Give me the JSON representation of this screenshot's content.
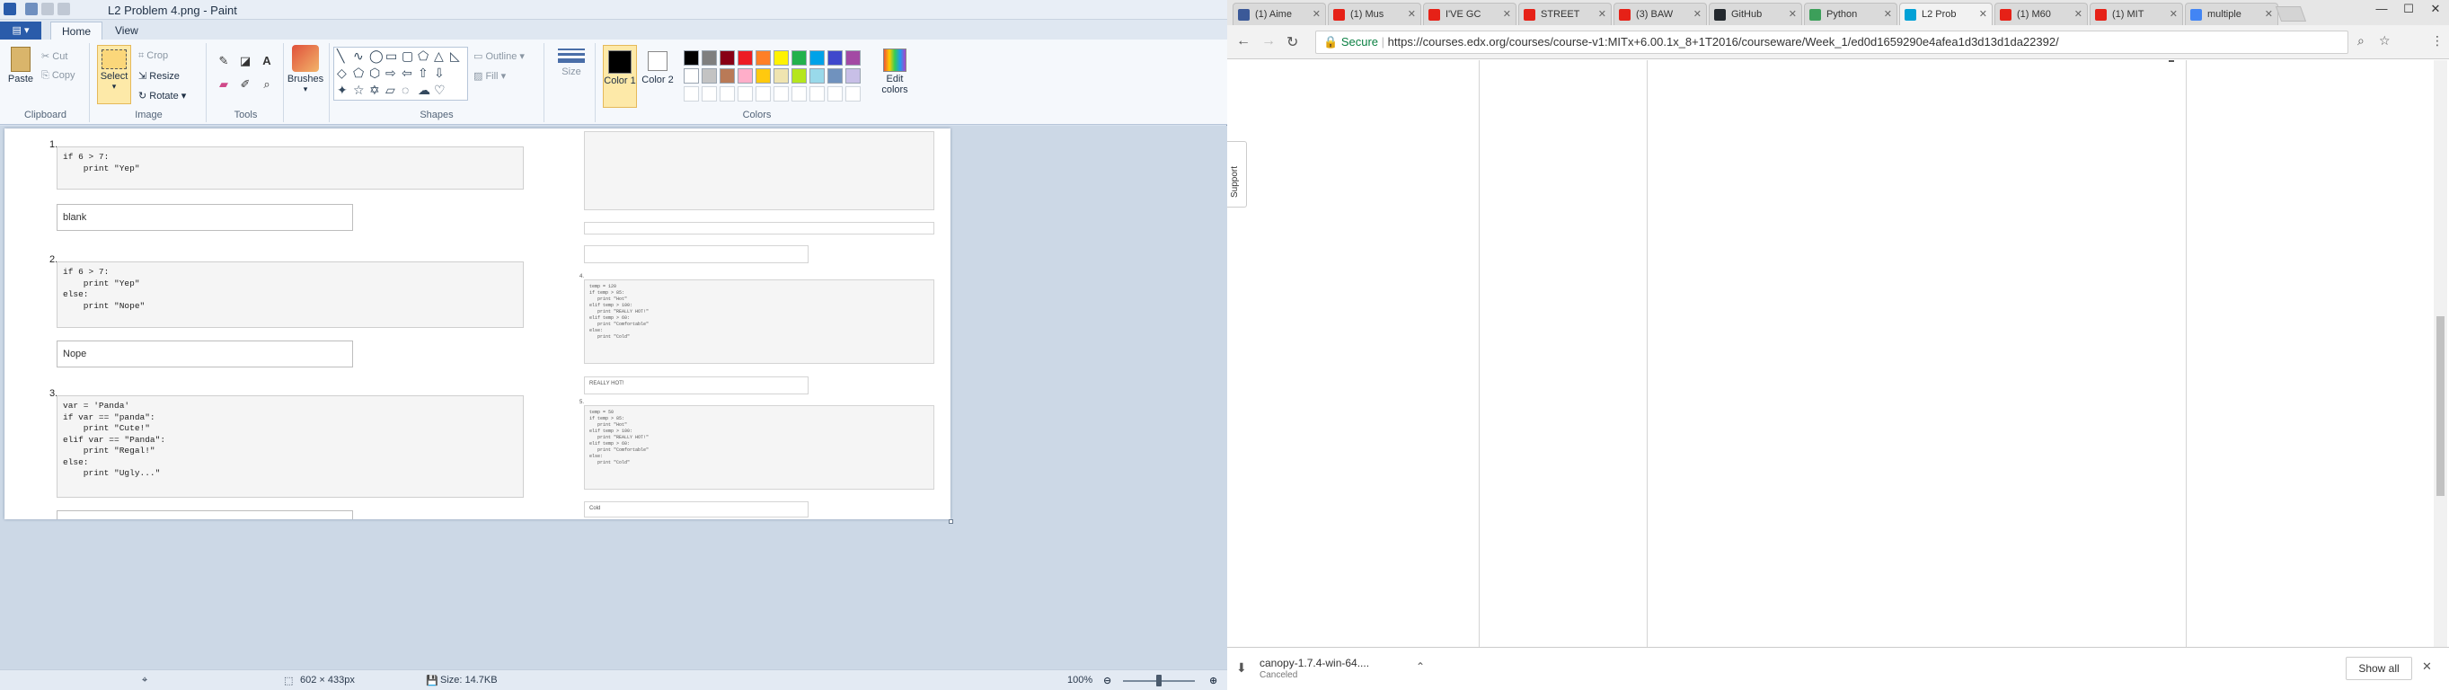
{
  "paint": {
    "title": "L2 Problem 4.png - Paint",
    "tabs": [
      "Home",
      "View"
    ],
    "ribbon": {
      "clipboard": {
        "label": "Clipboard",
        "paste": "Paste",
        "cut": "Cut",
        "copy": "Copy"
      },
      "image": {
        "label": "Image",
        "select": "Select",
        "crop": "Crop",
        "resize": "Resize",
        "rotate": "Rotate"
      },
      "tools": {
        "label": "Tools"
      },
      "brushes": "Brushes",
      "shapes": {
        "label": "Shapes",
        "outline": "Outline",
        "fill": "Fill"
      },
      "size": "Size",
      "color1": "Color 1",
      "color2": "Color 2",
      "colors": {
        "label": "Colors",
        "edit": "Edit colors",
        "palette": [
          "#000000",
          "#7f7f7f",
          "#880015",
          "#ed1c24",
          "#ff7f27",
          "#fff200",
          "#22b14c",
          "#00a2e8",
          "#3f48cc",
          "#a349a4",
          "#ffffff",
          "#c3c3c3",
          "#b97a57",
          "#ffaec9",
          "#ffc90e",
          "#efe4b0",
          "#b5e61d",
          "#99d9ea",
          "#7092be",
          "#c8bfe7"
        ]
      }
    },
    "canvas": {
      "q1": {
        "num": "1.",
        "code": "if 6 > 7:\n    print \"Yep\"",
        "answer": "blank"
      },
      "q2": {
        "num": "2.",
        "code": "if 6 > 7:\n    print \"Yep\"\nelse:\n    print \"Nope\"",
        "answer": "Nope"
      },
      "q3": {
        "num": "3.",
        "code": "var = 'Panda'\nif var == \"panda\":\n    print \"Cute!\"\nelif var == \"Panda\":\n    print \"Regal!\"\nelse:\n    print \"Ugly...\""
      },
      "small": {
        "s1": {
          "num": "4.",
          "code": "temp = 120\nif temp > 85:\n   print \"Hot\"\nelif temp > 100:\n   print \"REALLY HOT!\"\nelif temp > 60:\n   print \"Comfortable\"\nelse:\n   print \"Cold\""
        },
        "s2": {
          "num": "5.",
          "code": "temp = 50\nif temp > 85:\n   print \"Hot\"\nelif temp > 100:\n   print \"REALLY HOT!\"\nelif temp > 60:\n   print \"Comfortable\"\nelse:\n   print \"Cold\""
        },
        "a2": "REALLY HOT!",
        "a3": "Cold"
      }
    },
    "status": {
      "dims": "602 × 433px",
      "size": "Size: 14.7KB",
      "zoom": "100%"
    }
  },
  "chrome": {
    "tabs": [
      {
        "label": "(1) Aime",
        "color": "#3b5998"
      },
      {
        "label": "(1) Mus",
        "color": "#e62117"
      },
      {
        "label": "I'VE GC",
        "color": "#e62117"
      },
      {
        "label": "STREET",
        "color": "#e62117"
      },
      {
        "label": "(3) BAW",
        "color": "#e62117"
      },
      {
        "label": "GitHub",
        "color": "#24292e"
      },
      {
        "label": "Python",
        "color": "#3c9f5a"
      },
      {
        "label": "L2 Prob",
        "color": "#02a1d6"
      },
      {
        "label": "(1) M60",
        "color": "#e62117"
      },
      {
        "label": "(1) MIT",
        "color": "#e62117"
      },
      {
        "label": "multiple",
        "color": "#4285f4"
      }
    ],
    "secure": "Secure",
    "url": "https://courses.edx.org/courses/course-v1:MITx+6.00.1x_8+1T2016/courseware/Week_1/ed0d1659290e4afea1d3d13d1da22392/",
    "support": "Support",
    "download": {
      "name": "canopy-1.7.4-win-64....",
      "status": "Canceled",
      "show_all": "Show all"
    }
  }
}
